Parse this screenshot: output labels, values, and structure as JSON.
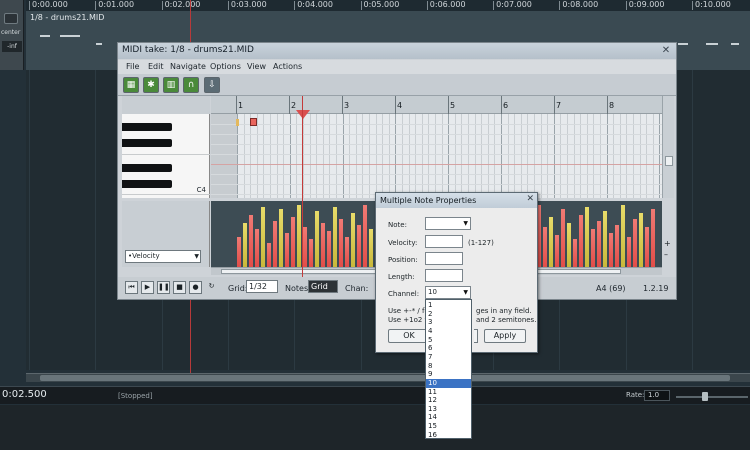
{
  "ruler": {
    "ticks": [
      "0:00.000",
      "0:01.000",
      "0:02.000",
      "0:03.000",
      "0:04.000",
      "0:05.000",
      "0:06.000",
      "0:07.000",
      "0:08.000",
      "0:09.000",
      "0:10.000"
    ]
  },
  "track": {
    "pan_label": "center",
    "volume": "-inf",
    "item_name": "1/8 - drums21.MID"
  },
  "transport": {
    "time": "0:02.500",
    "status": "[Stopped]",
    "rate_label": "Rate:",
    "rate_value": "1.0"
  },
  "midi_editor": {
    "title": "MIDI take: 1/8 - drums21.MID",
    "close_glyph": "✕",
    "menu": [
      "File",
      "Edit",
      "Navigate",
      "Options",
      "View",
      "Actions"
    ],
    "bars": [
      "1",
      "2",
      "3",
      "4",
      "5",
      "6",
      "7",
      "8"
    ],
    "key_label": "C4",
    "lane_select": "•Velocity",
    "plus_glyph": "+",
    "minus_glyph": "–",
    "grid_label": "Grid:",
    "grid_value": "1/32",
    "notes_label": "Notes:",
    "notes_value": "Grid",
    "chan_label": "Chan:",
    "note_readout": "A4 (69)",
    "pos_readout": "1.2.19"
  },
  "dialog": {
    "title": "Multiple Note Properties",
    "close_glyph": "✕",
    "note_label": "Note:",
    "velocity_label": "Velocity:",
    "velocity_range": "(1-127)",
    "position_label": "Position:",
    "length_label": "Length:",
    "channel_label": "Channel:",
    "channel_value": "10",
    "help_line1": "Use +-* / fo",
    "help_line1b": "ges in any field.",
    "help_line2": "Use +1o2 t",
    "help_line2b": "and 2 semitones.",
    "ok_label": "OK",
    "apply_label": "Apply",
    "channel_options": [
      "1",
      "2",
      "3",
      "4",
      "5",
      "6",
      "7",
      "8",
      "9",
      "10",
      "11",
      "12",
      "13",
      "14",
      "15",
      "16"
    ],
    "selected_channel": "10"
  }
}
